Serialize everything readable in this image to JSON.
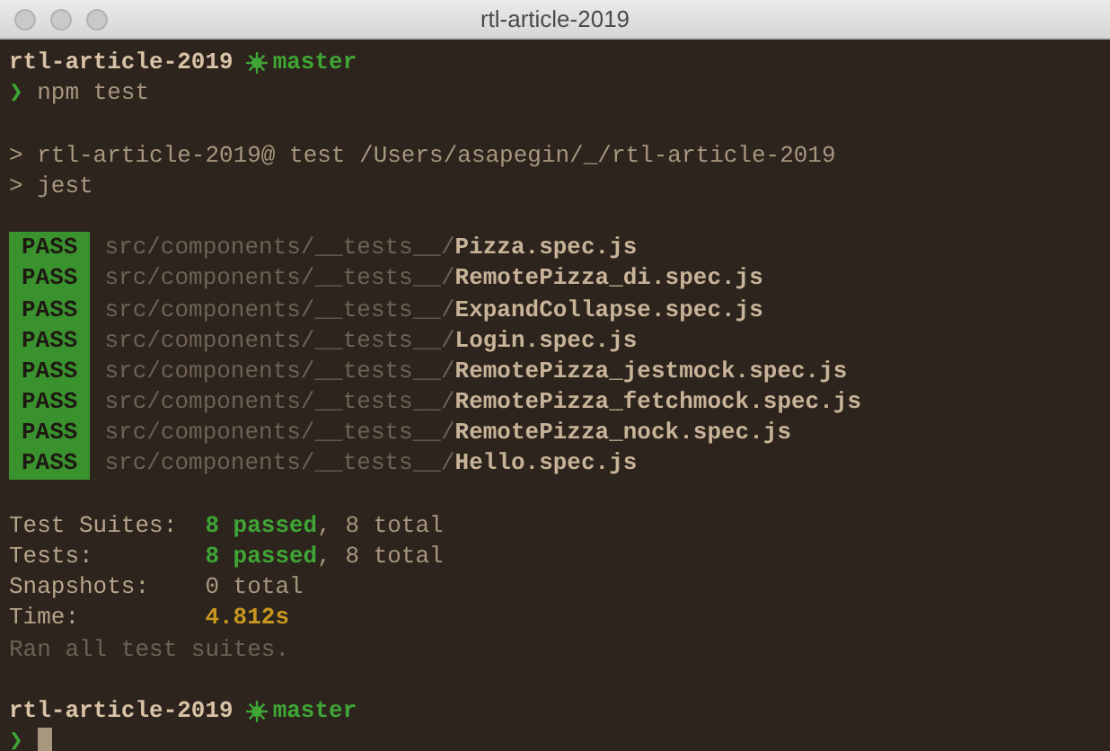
{
  "window": {
    "title": "rtl-article-2019"
  },
  "lines": [
    {
      "kind": "prompt",
      "dir": "rtl-article-2019",
      "branch": "master"
    },
    {
      "kind": "command",
      "chevron": "❯",
      "text": "npm test"
    },
    {
      "kind": "blank"
    },
    {
      "kind": "output",
      "text": "> rtl-article-2019@ test /Users/asapegin/_/rtl-article-2019"
    },
    {
      "kind": "output",
      "text": "> jest"
    },
    {
      "kind": "blank"
    },
    {
      "kind": "pass",
      "badge": "PASS",
      "path": "src/components/__tests__/**Pizza.spec.js**"
    },
    {
      "kind": "pass",
      "badge": "PASS",
      "path": "src/components/__tests__/**RemotePizza_di.spec.js**"
    },
    {
      "kind": "pass",
      "badge": "PASS",
      "path": "src/components/__tests__/**ExpandCollapse.spec.js**"
    },
    {
      "kind": "pass",
      "badge": "PASS",
      "path": "src/components/__tests__/**Login.spec.js**"
    },
    {
      "kind": "pass",
      "badge": "PASS",
      "path": "src/components/__tests__/**RemotePizza_jestmock.spec.js**"
    },
    {
      "kind": "pass",
      "badge": "PASS",
      "path": "src/components/__tests__/**RemotePizza_fetchmock.spec.js**"
    },
    {
      "kind": "pass",
      "badge": "PASS",
      "path": "src/components/__tests__/**RemotePizza_nock.spec.js**"
    },
    {
      "kind": "pass",
      "badge": "PASS",
      "path": "src/components/__tests__/**Hello.spec.js**"
    },
    {
      "kind": "blank"
    },
    {
      "kind": "summary",
      "label": "Test Suites:",
      "value": "**8 passed**, 8 total",
      "highlight": false
    },
    {
      "kind": "summary",
      "label": "Tests:",
      "value": "**8 passed**, 8 total",
      "highlight": false
    },
    {
      "kind": "summary",
      "label": "Snapshots:",
      "value": "0 total",
      "highlight": false
    },
    {
      "kind": "summary",
      "label": "Time:",
      "value": "4.812s",
      "highlight": true
    },
    {
      "kind": "dim",
      "text": "Ran all test suites."
    },
    {
      "kind": "blank"
    },
    {
      "kind": "prompt",
      "dir": "rtl-article-2019",
      "branch": "master"
    },
    {
      "kind": "cursor",
      "chevron": "❯"
    }
  ]
}
